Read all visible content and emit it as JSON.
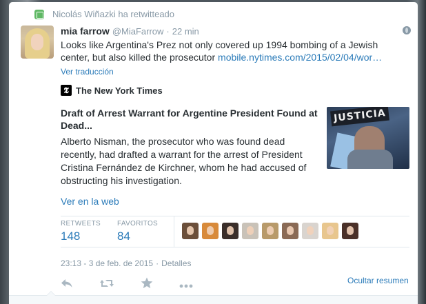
{
  "retweet_line": "Nicolás Wiñazki ha retwitteado",
  "author": {
    "name": "mia farrow",
    "handle": "@MiaFarrow",
    "separator": "·",
    "time": "22 min"
  },
  "tweet": {
    "text": "Looks like Argentina's Prez not only covered up 1994 bombing of a Jewish center, but also killed the prosecutor ",
    "link": "mobile.nytimes.com/2015/02/04/wor…"
  },
  "translate_label": "Ver traducción",
  "card": {
    "source_logo": "𝕿",
    "source_name": "The New York Times",
    "headline": "Draft of Arrest Warrant for Argentine President Found at Dead...",
    "summary": "Alberto Nisman, the prosecutor who was found dead recently, had drafted a warrant for the arrest of President Cristina Fernández de Kirchner, whom he had accused of obstructing his investigation.",
    "image_sign_text": "JUSTICIA",
    "web_link_label": "Ver en la web"
  },
  "stats": {
    "retweets_label": "RETWEETS",
    "retweets_value": "148",
    "favorites_label": "FAVORITOS",
    "favorites_value": "84"
  },
  "favoriter_avatars": [
    "#6b4f3a",
    "#d88a3a",
    "#3a2e2a",
    "#c9c2b8",
    "#b89a6a",
    "#8a6a55",
    "#d9d4cf",
    "#e8c68e",
    "#4a3028"
  ],
  "meta": {
    "timestamp": "23:13 - 3 de feb. de 2015",
    "separator": "·",
    "details_label": "Detalles"
  },
  "actions": {
    "reply_icon": "reply-icon",
    "retweet_icon": "retweet-icon",
    "favorite_icon": "star-icon",
    "more_icon": "more-icon",
    "collapse_label": "Ocultar resumen"
  },
  "colors": {
    "link": "#2b7bb9",
    "muted": "#8899a6",
    "retweet_green": "#5fb864"
  }
}
